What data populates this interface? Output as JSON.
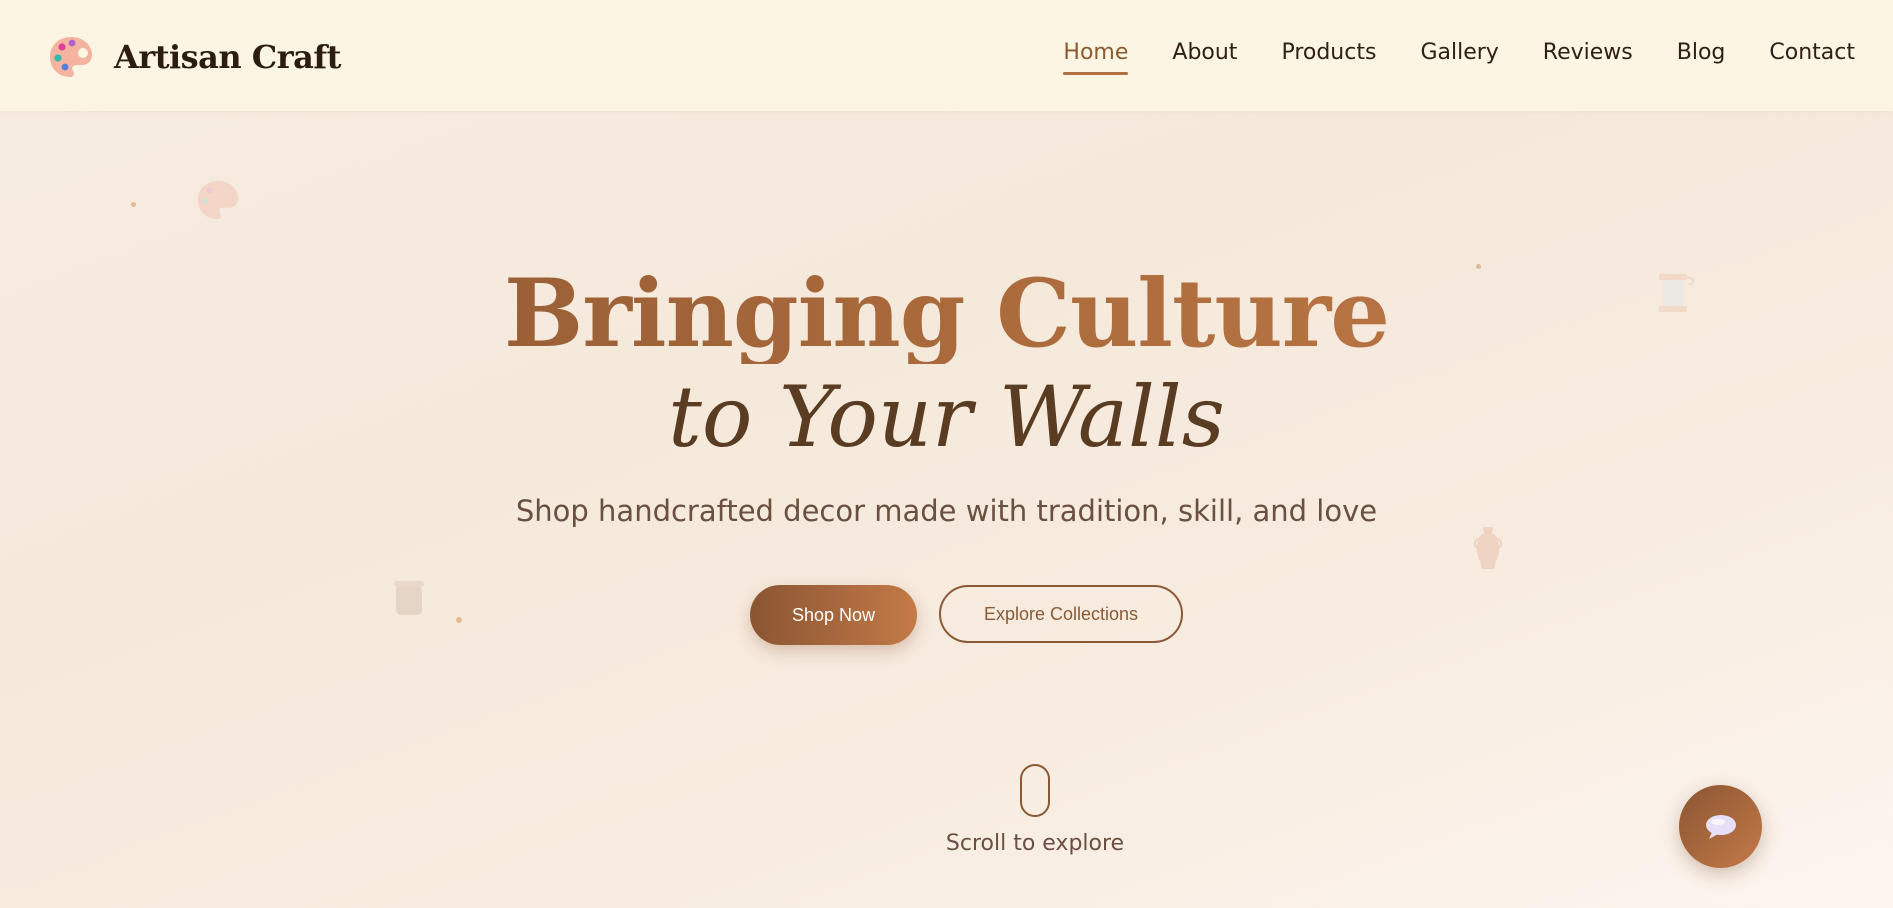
{
  "brand": {
    "name": "Artisan Craft",
    "icon": "palette-icon"
  },
  "nav": {
    "items": [
      {
        "label": "Home",
        "active": true
      },
      {
        "label": "About",
        "active": false
      },
      {
        "label": "Products",
        "active": false
      },
      {
        "label": "Gallery",
        "active": false
      },
      {
        "label": "Reviews",
        "active": false
      },
      {
        "label": "Blog",
        "active": false
      },
      {
        "label": "Contact",
        "active": false
      }
    ]
  },
  "hero": {
    "title_line1": "Bringing Culture",
    "title_line2": "to Your Walls",
    "subtitle": "Shop handcrafted decor made with tradition, skill, and love",
    "primary_cta": "Shop Now",
    "secondary_cta": "Explore Collections",
    "scroll_label": "Scroll to explore"
  },
  "chat": {
    "icon": "speech-bubble-icon"
  },
  "colors": {
    "accent": "#b07040",
    "accent_dark": "#8a5532",
    "header_bg": "#fdf5e4",
    "text_dark": "#2c1d12"
  }
}
